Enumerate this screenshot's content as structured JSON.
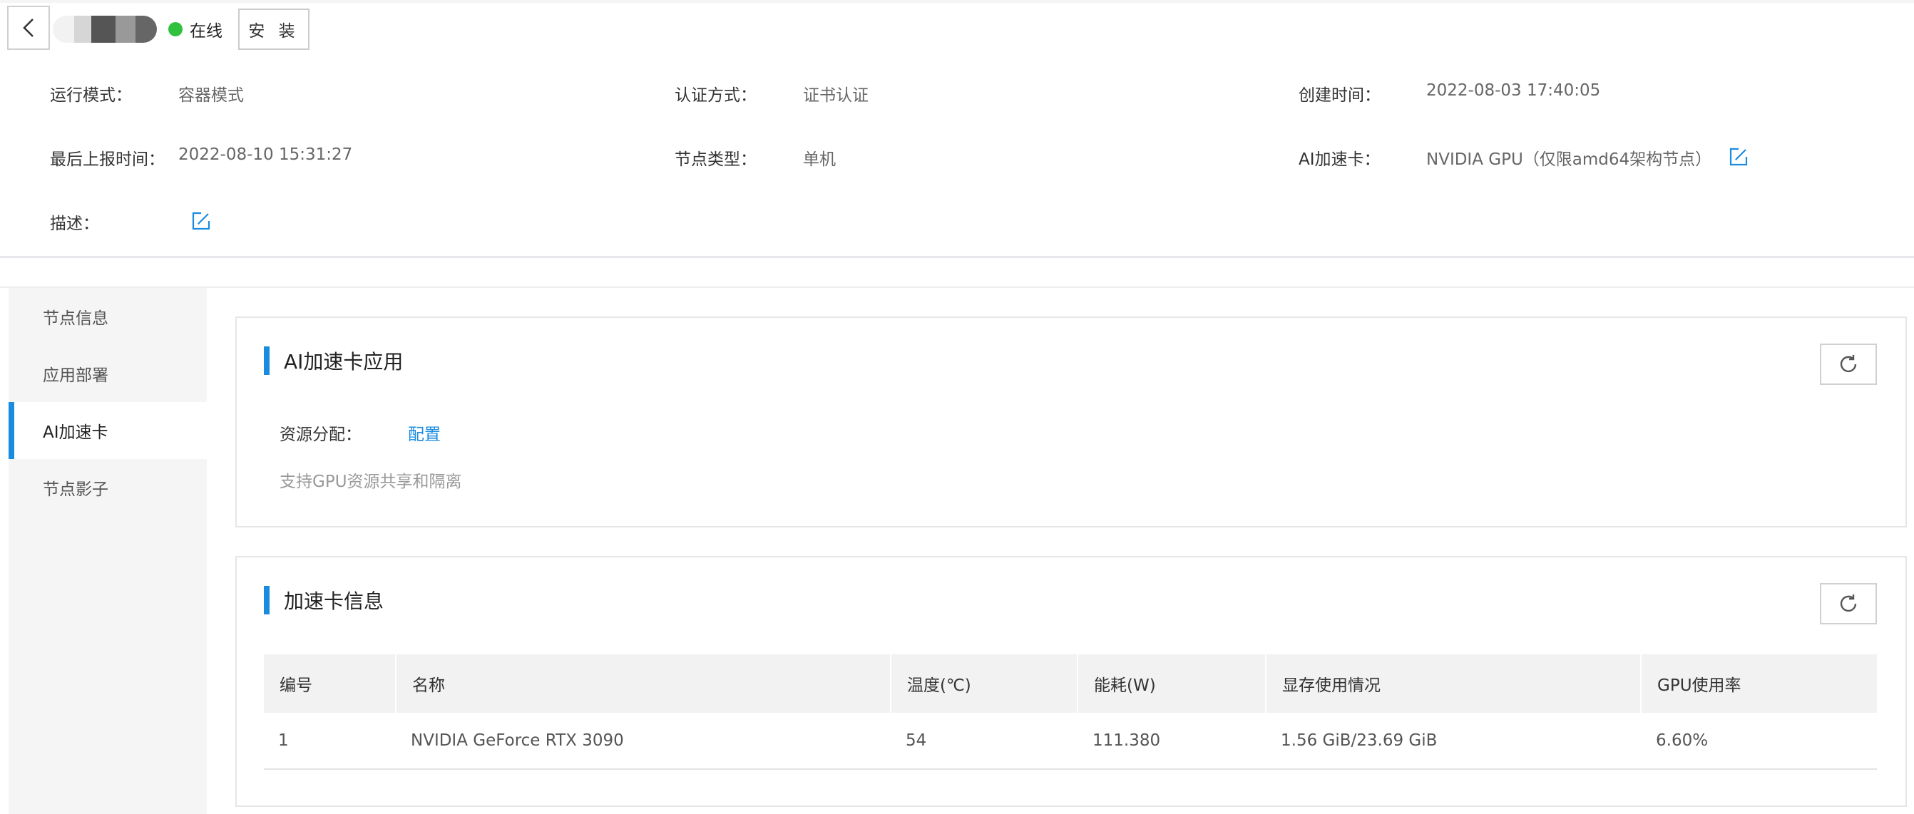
{
  "header": {
    "status_text": "在线",
    "install_label": "安 装"
  },
  "info": {
    "run_mode": {
      "label": "运行模式：",
      "value": "容器模式"
    },
    "auth_method": {
      "label": "认证方式：",
      "value": "证书认证"
    },
    "created_time": {
      "label": "创建时间：",
      "value": "2022-08-03 17:40:05"
    },
    "last_report": {
      "label": "最后上报时间：",
      "value": "2022-08-10 15:31:27"
    },
    "node_type": {
      "label": "节点类型：",
      "value": "单机"
    },
    "ai_card": {
      "label": "AI加速卡：",
      "value": "NVIDIA GPU（仅限amd64架构节点）"
    },
    "description": {
      "label": "描述："
    }
  },
  "sidebar": {
    "items": [
      {
        "label": "节点信息"
      },
      {
        "label": "应用部署"
      },
      {
        "label": "AI加速卡"
      },
      {
        "label": "节点影子"
      }
    ],
    "active_index": 2
  },
  "ai_app_card": {
    "title": "AI加速卡应用",
    "resource_label": "资源分配：",
    "config_link": "配置",
    "hint": "支持GPU资源共享和隔离"
  },
  "card_info": {
    "title": "加速卡信息",
    "columns": [
      "编号",
      "名称",
      "温度(℃)",
      "能耗(W)",
      "显存使用情况",
      "GPU使用率"
    ],
    "rows": [
      [
        "1",
        "NVIDIA GeForce RTX 3090",
        "54",
        "111.380",
        "1.56 GiB/23.69 GiB",
        "6.60%"
      ]
    ]
  },
  "colors": {
    "accent": "#1a8ce0",
    "online": "#30c23f",
    "sidebar_bg": "#f5f5f5"
  },
  "icons": [
    "chevron-left-icon",
    "status-dot-icon",
    "edit-icon",
    "refresh-icon"
  ]
}
